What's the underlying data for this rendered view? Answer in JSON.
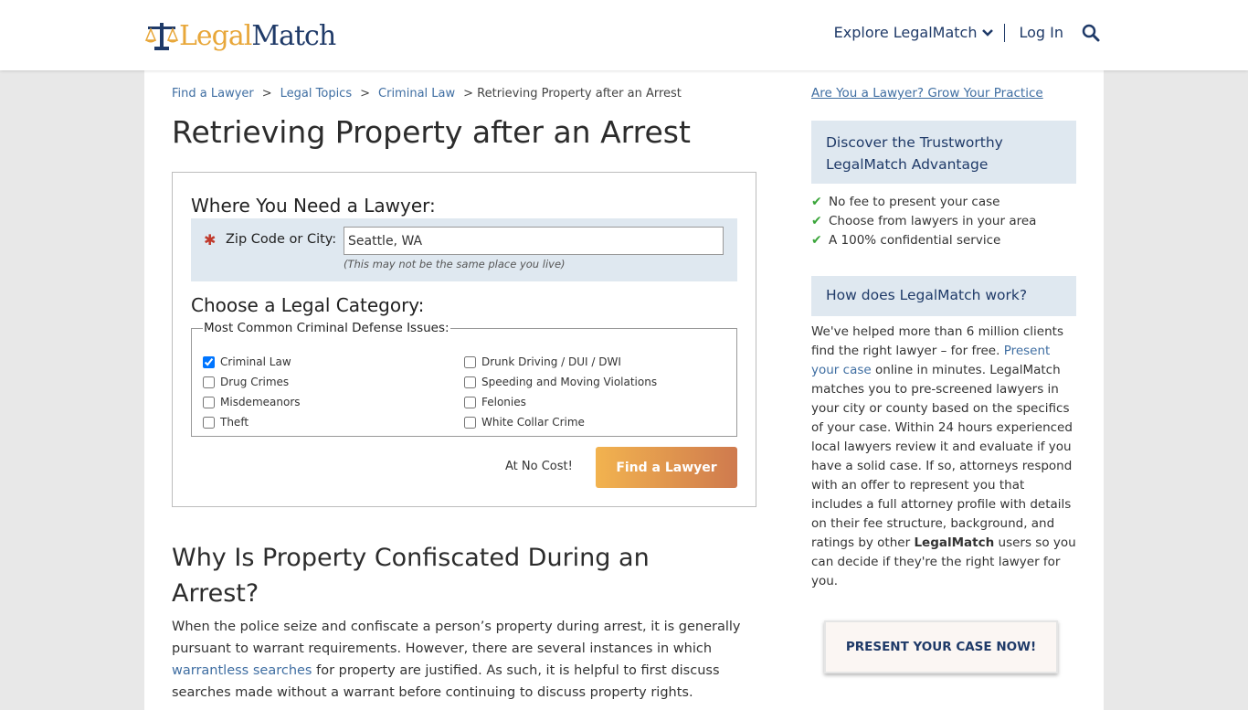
{
  "header": {
    "logo_legal": "Legal",
    "logo_match": "Match",
    "explore": "Explore LegalMatch",
    "login": "Log In"
  },
  "breadcrumb": [
    "Find a Lawyer",
    "Legal Topics",
    "Criminal Law",
    "Retrieving Property after an Arrest"
  ],
  "page_title": "Retrieving Property after an Arrest",
  "form": {
    "where_heading": "Where You Need a Lawyer:",
    "zip_label": "Zip Code or City:",
    "zip_value": "Seattle, WA",
    "zip_hint": "(This may not be the same place you live)",
    "category_heading": "Choose a Legal Category:",
    "legend": "Most Common Criminal Defense Issues:",
    "categories": [
      {
        "label": "Criminal Law",
        "checked": true
      },
      {
        "label": "Drunk Driving / DUI / DWI",
        "checked": false
      },
      {
        "label": "Drug Crimes",
        "checked": false
      },
      {
        "label": "Speeding and Moving Violations",
        "checked": false
      },
      {
        "label": "Misdemeanors",
        "checked": false
      },
      {
        "label": "Felonies",
        "checked": false
      },
      {
        "label": "Theft",
        "checked": false
      },
      {
        "label": "White Collar Crime",
        "checked": false
      }
    ],
    "no_cost": "At No Cost!",
    "find_button": "Find a Lawyer"
  },
  "section": {
    "heading": "Why Is Property Confiscated During an Arrest?",
    "p1": "When the police seize and confiscate a person’s property during arrest, it is generally pursuant to warrant requirements. However, there are several instances in which",
    "link": "warrantless searches",
    "p2": "for property are justified. As such, it is helpful to first discuss searches made without a warrant before continuing to discuss property rights."
  },
  "sidebar": {
    "grow_link": "Are You a Lawyer? Grow Your Practice",
    "advantage_title": "Discover the Trustworthy LegalMatch Advantage",
    "benefits": [
      "No fee to present your case",
      "Choose from lawyers in your area",
      "A 100% confidential service"
    ],
    "how_title": "How does LegalMatch work?",
    "how_p1": "We've helped more than 6 million clients find the right lawyer – for free.",
    "how_link": "Present your case",
    "how_p2": "online in minutes. LegalMatch matches you to pre-screened lawyers in your city or county based on the specifics of your case. Within 24 hours experienced local lawyers review it and evaluate if you have a solid case. If so, attorneys respond with an offer to represent you that includes a full attorney profile with details on their fee structure, background, and ratings by other",
    "how_brand": "LegalMatch",
    "how_p3": "users so you can decide if they're the right lawyer for you.",
    "present_button": "PRESENT YOUR CASE NOW!"
  },
  "colors": {
    "navy": "#1f3a68",
    "gold": "#e8a73a",
    "link": "#3f6ea2",
    "panel": "#dfe8f0"
  }
}
